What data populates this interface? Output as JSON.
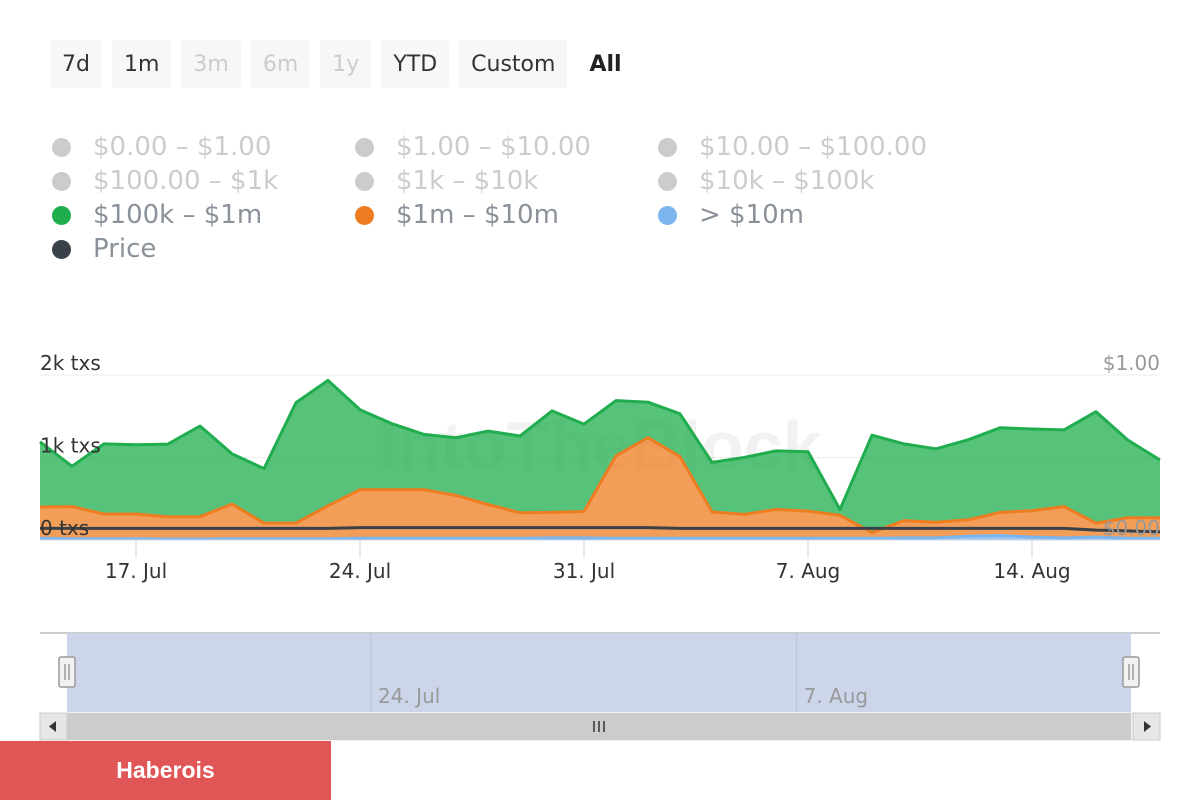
{
  "range_selector": [
    {
      "label": "7d",
      "state": "normal"
    },
    {
      "label": "1m",
      "state": "normal"
    },
    {
      "label": "3m",
      "state": "disabled"
    },
    {
      "label": "6m",
      "state": "disabled"
    },
    {
      "label": "1y",
      "state": "disabled"
    },
    {
      "label": "YTD",
      "state": "normal"
    },
    {
      "label": "Custom",
      "state": "normal"
    },
    {
      "label": "All",
      "state": "active"
    }
  ],
  "legend": [
    {
      "label": "$0.00 – $1.00",
      "color": "#cccccc",
      "visible": false
    },
    {
      "label": "$1.00 – $10.00",
      "color": "#cccccc",
      "visible": false
    },
    {
      "label": "$10.00 – $100.00",
      "color": "#cccccc",
      "visible": false
    },
    {
      "label": "$100.00 – $1k",
      "color": "#cccccc",
      "visible": false
    },
    {
      "label": "$1k – $10k",
      "color": "#cccccc",
      "visible": false
    },
    {
      "label": "$10k – $100k",
      "color": "#cccccc",
      "visible": false
    },
    {
      "label": "$100k – $1m",
      "color": "#1fad4e",
      "visible": true
    },
    {
      "label": "$1m – $10m",
      "color": "#ee7d22",
      "visible": true
    },
    {
      "label": "> $10m",
      "color": "#7cb5ec",
      "visible": true
    },
    {
      "label": "Price",
      "color": "#3b4148",
      "visible": true
    }
  ],
  "chart_data": {
    "type": "area",
    "stacking": "normal",
    "x": [
      "2023-07-14",
      "2023-07-15",
      "2023-07-16",
      "2023-07-17",
      "2023-07-18",
      "2023-07-19",
      "2023-07-20",
      "2023-07-21",
      "2023-07-22",
      "2023-07-23",
      "2023-07-24",
      "2023-07-25",
      "2023-07-26",
      "2023-07-27",
      "2023-07-28",
      "2023-07-29",
      "2023-07-30",
      "2023-07-31",
      "2023-08-01",
      "2023-08-02",
      "2023-08-03",
      "2023-08-04",
      "2023-08-05",
      "2023-08-06",
      "2023-08-07",
      "2023-08-08",
      "2023-08-09",
      "2023-08-10",
      "2023-08-11",
      "2023-08-12",
      "2023-08-13",
      "2023-08-14",
      "2023-08-15",
      "2023-08-16",
      "2023-08-17",
      "2023-08-18"
    ],
    "series": [
      {
        "name": "> $10m",
        "color": "#7cb5ec",
        "values": [
          20,
          15,
          15,
          15,
          12,
          12,
          15,
          15,
          15,
          15,
          20,
          20,
          20,
          20,
          20,
          20,
          25,
          25,
          20,
          20,
          20,
          20,
          20,
          20,
          20,
          20,
          20,
          25,
          25,
          45,
          55,
          35,
          25,
          35,
          20,
          20
        ]
      },
      {
        "name": "$1m – $10m",
        "color": "#ee7d22",
        "values": [
          380,
          390,
          300,
          300,
          270,
          270,
          420,
          190,
          190,
          400,
          590,
          590,
          590,
          520,
          410,
          310,
          310,
          320,
          1000,
          1220,
          990,
          320,
          290,
          350,
          330,
          280,
          70,
          210,
          190,
          200,
          280,
          320,
          380,
          170,
          250,
          250
        ]
      },
      {
        "name": "$100k – $1m",
        "color": "#1fad4e",
        "values": [
          790,
          490,
          850,
          840,
          880,
          1100,
          610,
          660,
          1460,
          1520,
          970,
          800,
          670,
          700,
          890,
          930,
          1230,
          1060,
          670,
          430,
          520,
          600,
          690,
          710,
          720,
          70,
          1180,
          930,
          890,
          970,
          1025,
          990,
          930,
          1350,
          940,
          700
        ]
      },
      {
        "name": "Price",
        "color": "#3b4148",
        "axis": "right",
        "values": [
          0.07,
          0.07,
          0.07,
          0.07,
          0.07,
          0.07,
          0.07,
          0.07,
          0.07,
          0.07,
          0.075,
          0.075,
          0.075,
          0.075,
          0.075,
          0.075,
          0.075,
          0.075,
          0.075,
          0.075,
          0.07,
          0.07,
          0.07,
          0.07,
          0.07,
          0.07,
          0.07,
          0.07,
          0.07,
          0.07,
          0.07,
          0.07,
          0.07,
          0.06,
          0.055,
          0.05
        ]
      }
    ],
    "x_ticks": [
      {
        "date": "2023-07-17",
        "label": "17. Jul"
      },
      {
        "date": "2023-07-24",
        "label": "24. Jul"
      },
      {
        "date": "2023-07-31",
        "label": "31. Jul"
      },
      {
        "date": "2023-08-07",
        "label": "7. Aug"
      },
      {
        "date": "2023-08-14",
        "label": "14. Aug"
      }
    ],
    "y_left": {
      "ticks": [
        {
          "value": 0,
          "label": "0 txs"
        },
        {
          "value": 1000,
          "label": "1k txs"
        },
        {
          "value": 2000,
          "label": "2k txs"
        }
      ],
      "range": [
        0,
        2000
      ]
    },
    "y_right": {
      "ticks": [
        {
          "value": 0,
          "label": "$0.00"
        },
        {
          "value": 1,
          "label": "$1.00"
        }
      ],
      "range": [
        0,
        1
      ]
    },
    "navigator": {
      "ticks": [
        {
          "date": "2023-07-24",
          "label": "24. Jul"
        },
        {
          "date": "2023-08-07",
          "label": "7. Aug"
        }
      ],
      "selected_range": [
        "2023-07-14",
        "2023-08-18"
      ]
    },
    "watermark": "IntoTheBlock"
  },
  "footer": {
    "badge_text": "Haberois"
  }
}
